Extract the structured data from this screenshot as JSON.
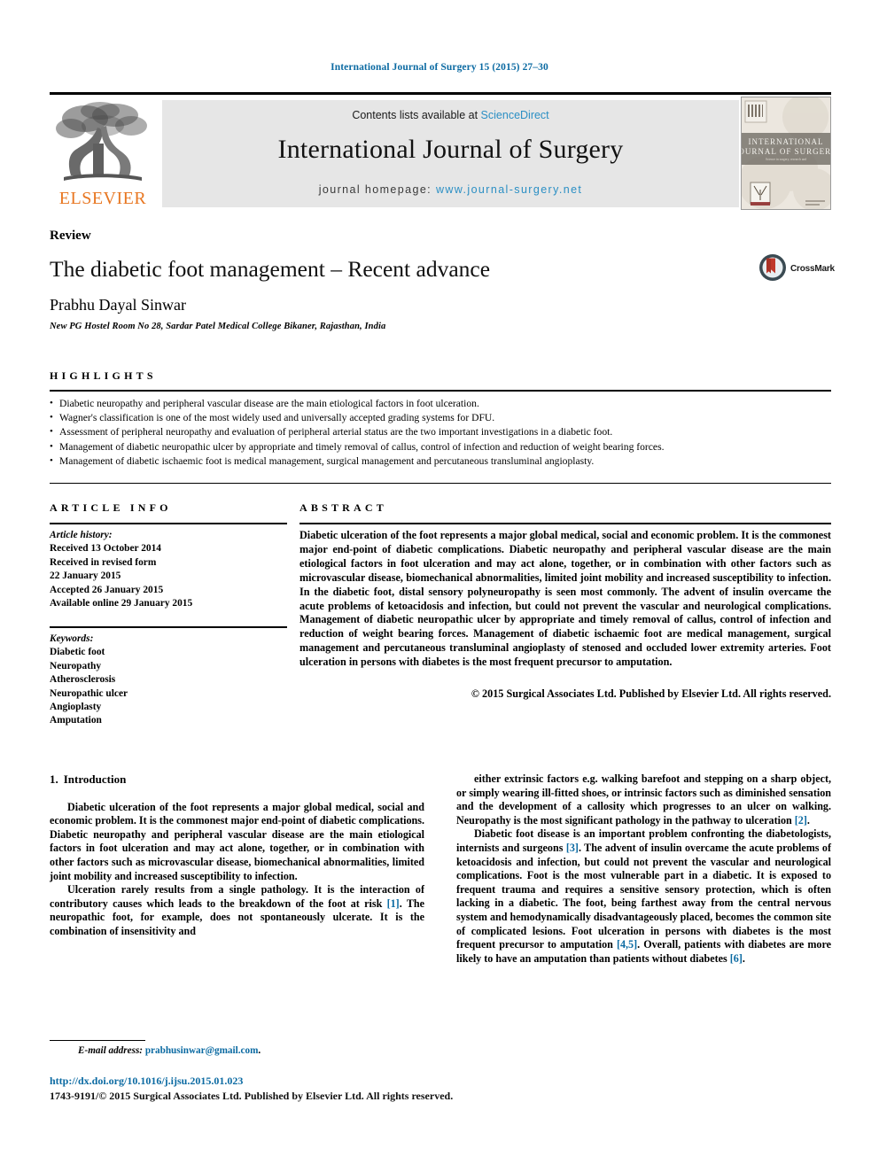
{
  "running_head": "International Journal of Surgery 15 (2015) 27–30",
  "masthead": {
    "publisher_name": "ELSEVIER",
    "contents_prefix": "Contents lists available at",
    "contents_link": "ScienceDirect",
    "journal_title": "International Journal of Surgery",
    "homepage_label": "journal homepage:",
    "homepage_url": "www.journal-surgery.net",
    "cover_title_line1": "INTERNATIONAL",
    "cover_title_line2": "JOURNAL OF SURGERY"
  },
  "article": {
    "doctype": "Review",
    "title": "The diabetic foot management – Recent advance",
    "author": "Prabhu Dayal Sinwar",
    "affiliation": "New PG Hostel Room No 28, Sardar Patel Medical College Bikaner, Rajasthan, India",
    "crossmark_label": "CrossMark"
  },
  "highlights": {
    "heading": "HIGHLIGHTS",
    "items": [
      "Diabetic neuropathy and peripheral vascular disease are the main etiological factors in foot ulceration.",
      "Wagner's classification is one of the most widely used and universally accepted grading systems for DFU.",
      "Assessment of peripheral neuropathy and evaluation of peripheral arterial status are the two important investigations in a diabetic foot.",
      "Management of diabetic neuropathic ulcer by appropriate and timely removal of callus, control of infection and reduction of weight bearing forces.",
      "Management of diabetic ischaemic foot is medical management, surgical management and percutaneous transluminal angioplasty."
    ]
  },
  "article_info": {
    "heading": "ARTICLE INFO",
    "history_title": "Article history:",
    "history_lines": [
      "Received 13 October 2014",
      "Received in revised form",
      "22 January 2015",
      "Accepted 26 January 2015",
      "Available online 29 January 2015"
    ],
    "keywords_title": "Keywords:",
    "keywords": [
      "Diabetic foot",
      "Neuropathy",
      "Atherosclerosis",
      "Neuropathic ulcer",
      "Angioplasty",
      "Amputation"
    ]
  },
  "abstract": {
    "heading": "ABSTRACT",
    "text": "Diabetic ulceration of the foot represents a major global medical, social and economic problem. It is the commonest major end-point of diabetic complications. Diabetic neuropathy and peripheral vascular disease are the main etiological factors in foot ulceration and may act alone, together, or in combination with other factors such as microvascular disease, biomechanical abnormalities, limited joint mobility and increased susceptibility to infection. In the diabetic foot, distal sensory polyneuropathy is seen most commonly. The advent of insulin overcame the acute problems of ketoacidosis and infection, but could not prevent the vascular and neurological complications. Management of diabetic neuropathic ulcer by appropriate and timely removal of callus, control of infection and reduction of weight bearing forces. Management of diabetic ischaemic foot are medical management, surgical management and percutaneous transluminal angioplasty of stenosed and occluded lower extremity arteries. Foot ulceration in persons with diabetes is the most frequent precursor to amputation.",
    "copyright": "© 2015 Surgical Associates Ltd. Published by Elsevier Ltd. All rights reserved."
  },
  "body": {
    "section_number": "1.",
    "section_title": "Introduction",
    "left_paragraphs": [
      "Diabetic ulceration of the foot represents a major global medical, social and economic problem. It is the commonest major end-point of diabetic complications. Diabetic neuropathy and peripheral vascular disease are the main etiological factors in foot ulceration and may act alone, together, or in combination with other factors such as microvascular disease, biomechanical abnormalities, limited joint mobility and increased susceptibility to infection.",
      "Ulceration rarely results from a single pathology. It is the interaction of contributory causes which leads to the breakdown of the foot at risk [1]. The neuropathic foot, for example, does not spontaneously ulcerate. It is the combination of insensitivity and"
    ],
    "right_paragraphs": [
      "either extrinsic factors e.g. walking barefoot and stepping on a sharp object, or simply wearing ill-fitted shoes, or intrinsic factors such as diminished sensation and the development of a callosity which progresses to an ulcer on walking. Neuropathy is the most significant pathology in the pathway to ulceration [2].",
      "Diabetic foot disease is an important problem confronting the diabetologists, internists and surgeons [3]. The advent of insulin overcame the acute problems of ketoacidosis and infection, but could not prevent the vascular and neurological complications. Foot is the most vulnerable part in a diabetic. It is exposed to frequent trauma and requires a sensitive sensory protection, which is often lacking in a diabetic. The foot, being farthest away from the central nervous system and hemodynamically disadvantageously placed, becomes the common site of complicated lesions. Foot ulceration in persons with diabetes is the most frequent precursor to amputation [4,5]. Overall, patients with diabetes are more likely to have an amputation than patients without diabetes [6]."
    ]
  },
  "footer": {
    "email_label": "E-mail address:",
    "email_address": "prabhusinwar@gmail.com",
    "email_suffix": ".",
    "doi": "http://dx.doi.org/10.1016/j.ijsu.2015.01.023",
    "issn_line": "1743-9191/© 2015 Surgical Associates Ltd. Published by Elsevier Ltd. All rights reserved."
  },
  "colors": {
    "link": "#0b6aa2",
    "sciencedirect": "#2b8fc4",
    "elsevier_orange": "#e87722",
    "band": "#e6e6e6"
  }
}
